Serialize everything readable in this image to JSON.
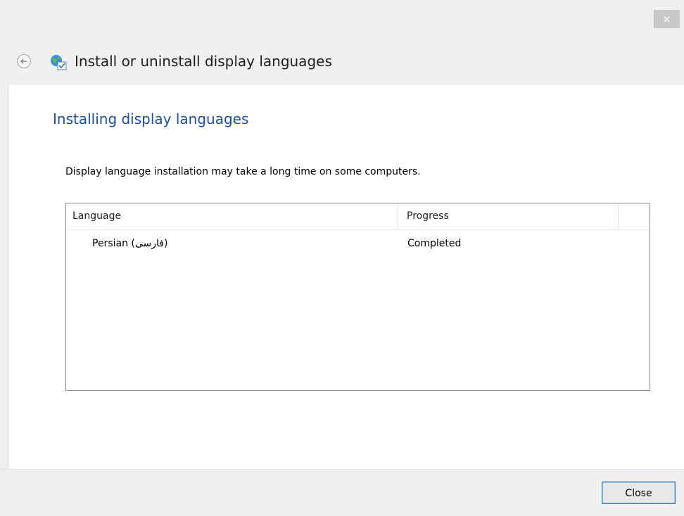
{
  "window": {
    "title": "Install or uninstall display languages",
    "close_glyph": "×"
  },
  "main": {
    "heading": "Installing display languages",
    "description": "Display language installation may take a long time on some computers."
  },
  "list": {
    "columns": [
      "Language",
      "Progress"
    ],
    "rows": [
      {
        "language": "Persian (فارسی)",
        "progress": "Completed"
      }
    ]
  },
  "footer": {
    "close_label": "Close"
  },
  "colors": {
    "heading": "#1f4e9c",
    "button_border": "#3c7fb1"
  },
  "icons": {
    "back": "back-arrow-icon",
    "window": "globe-language-icon",
    "close": "close-icon"
  }
}
